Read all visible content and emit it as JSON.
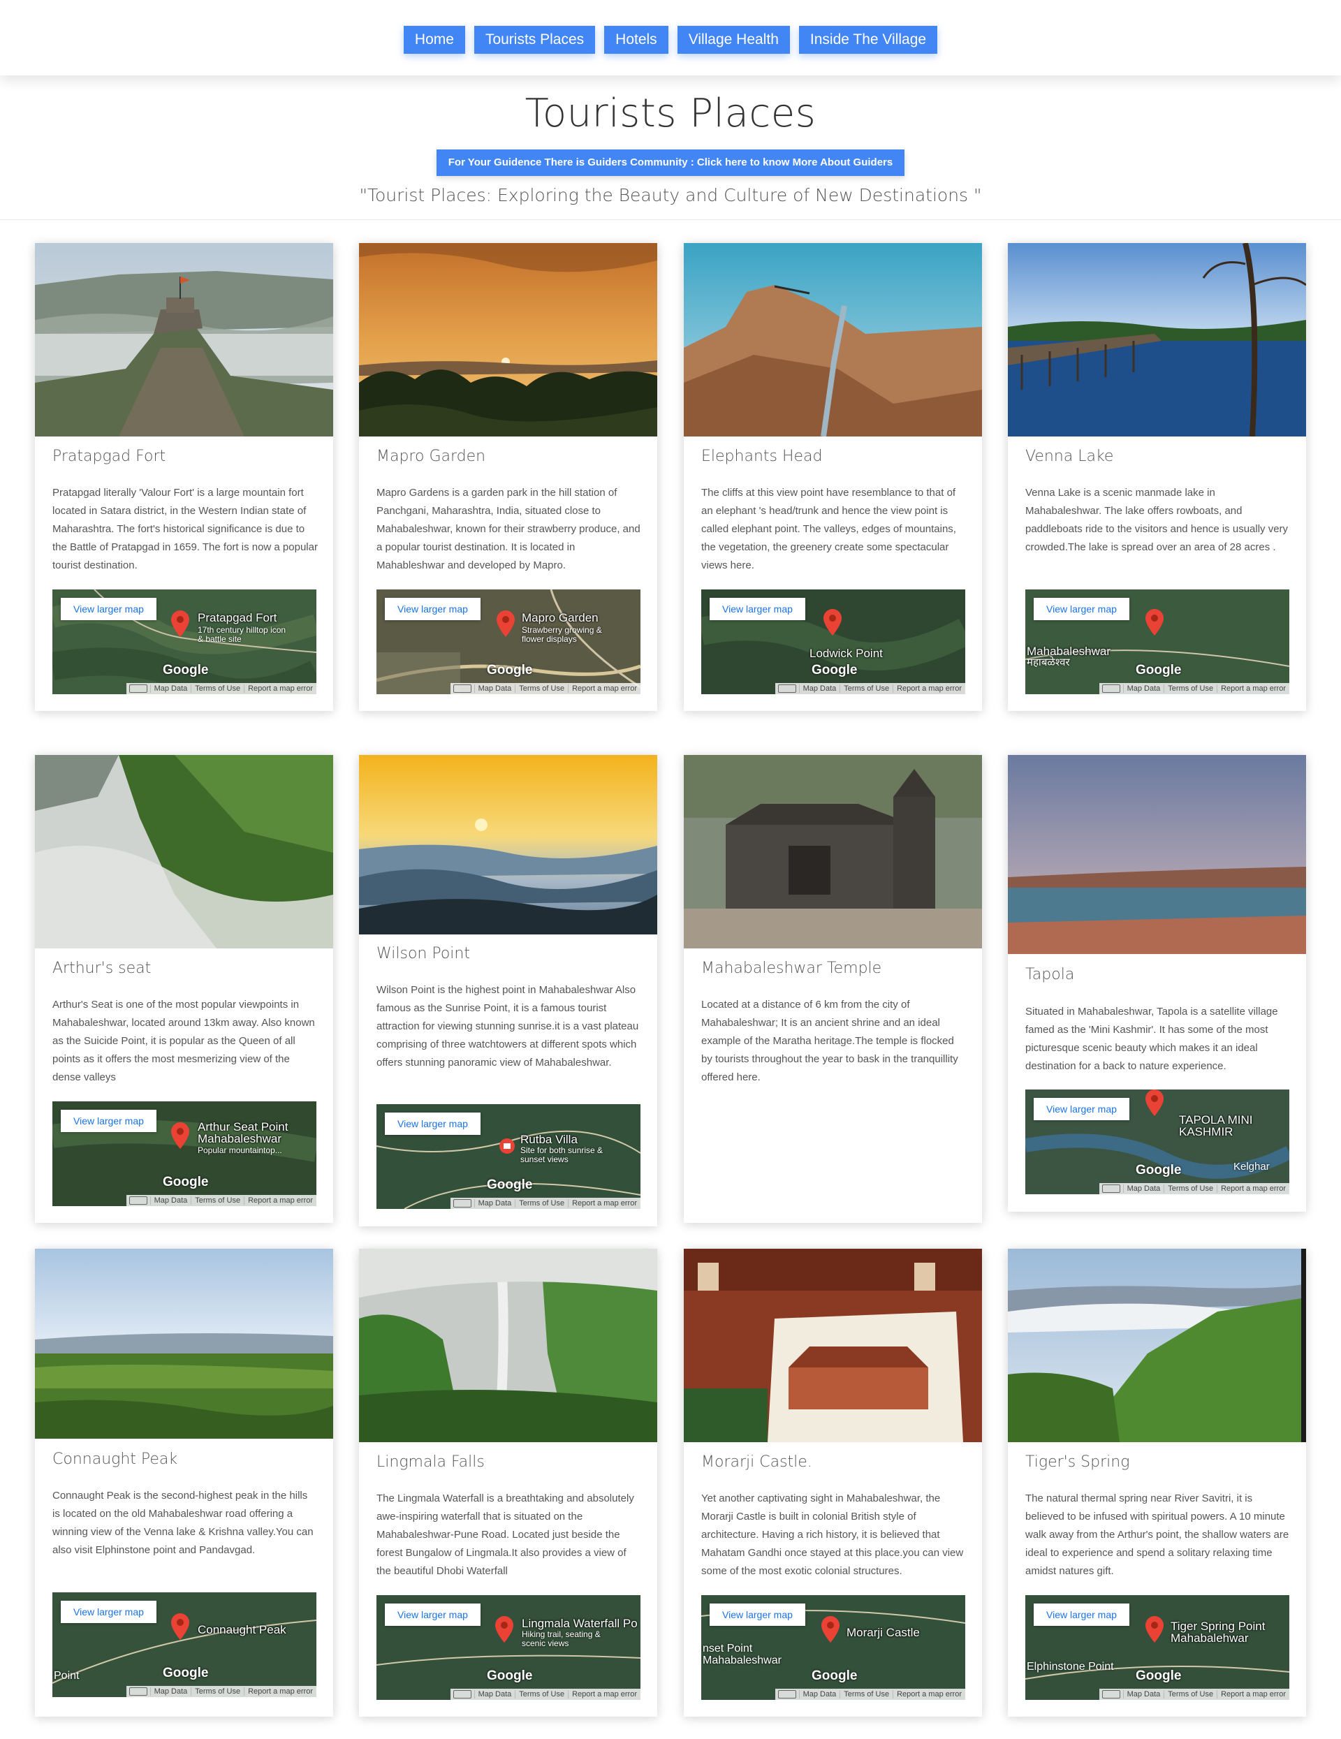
{
  "nav": [
    "Home",
    "Tourists Places",
    "Hotels",
    "Village Health",
    "Inside The Village"
  ],
  "header": {
    "title": "Tourists Places",
    "guide_button": "For Your Guidence There is Guiders Community : Click here to know More About Guiders",
    "tagline": "\"Tourist Places: Exploring the Beauty and Culture of New Destinations \""
  },
  "map_common": {
    "link": "View larger map",
    "google": "Google",
    "map_data": "Map Data",
    "terms": "Terms of Use",
    "report": "Report a map error"
  },
  "cards": [
    {
      "title": "Pratapgad Fort",
      "desc": "Pratapgad literally 'Valour Fort' is a large mountain fort located in Satara district, in the Western Indian state of Maharashtra. The fort's historical significance is due to the Battle of Pratapgad in 1659. The fort is now a popular tourist destination.",
      "map_label": "Pratapgad Fort",
      "map_sub": "17th century hilltop icon & battle site"
    },
    {
      "title": "Mapro Garden",
      "desc": "Mapro Gardens is a garden park in the hill station of Panchgani, Maharashtra, India, situated close to Mahabaleshwar, known for their strawberry produce, and a popular tourist destination. It is located in Mahableshwar and developed by Mapro.",
      "map_label": "Mapro Garden",
      "map_sub": "Strawberry growing & flower displays"
    },
    {
      "title": "Elephants Head",
      "desc": "The cliffs at this view point have resemblance to that of an elephant 's head/trunk and hence the view point is called elephant point. The valleys, edges of mountains, the vegetation, the greenery create some spectacular views here.",
      "map_label": "Lodwick Point",
      "map_sub": ""
    },
    {
      "title": "Venna Lake",
      "desc": "Venna Lake is a scenic manmade lake in Mahabaleshwar. The lake offers rowboats, and paddleboats ride to the visitors and hence is usually very crowded.The lake is spread over an area of 28 acres .",
      "map_label": "Mahabaleshwar",
      "map_sub": "महाबळेश्वर"
    },
    {
      "title": "Arthur's seat",
      "desc": "Arthur's Seat is one of the most popular viewpoints in Mahabaleshwar, located around 13km away. Also known as the Suicide Point, it is popular as the Queen of all points as it offers the most mesmerizing view of the dense valleys",
      "map_label": "Arthur Seat Point Mahabaleshwar",
      "map_sub": "Popular mountaintop..."
    },
    {
      "title": "Wilson Point",
      "desc": "Wilson Point is the highest point in Mahabaleshwar Also famous as the Sunrise Point, it is a famous tourist attraction for viewing stunning sunrise.it is a vast plateau comprising of three watchtowers at different spots which offers stunning panoramic view of Mahabaleshwar.",
      "map_label": "Rutba Villa",
      "map_sub": "Site for both sunrise & sunset views"
    },
    {
      "title": "Mahabaleshwar Temple",
      "desc": "Located at a distance of 6 km from the city of Mahabaleshwar; It is an ancient shrine and an ideal example of the Maratha heritage.The temple is flocked by tourists throughout the year to bask in the tranquillity offered here.",
      "map_label": "",
      "map_sub": ""
    },
    {
      "title": "Tapola",
      "desc": "Situated in Mahabaleshwar, Tapola is a satellite village famed as the 'Mini Kashmir'. It has some of the most picturesque scenic beauty which makes it an ideal destination for a back to nature experience.",
      "map_label": "TAPOLA MINI KASHMIR",
      "map_sub": "Kelghar"
    },
    {
      "title": "Connaught Peak",
      "desc": "Connaught Peak is the second-highest peak in the hills is located on the old Mahabaleshwar road offering a winning view of the Venna lake & Krishna valley.You can also visit Elphinstone point and Pandavgad.",
      "map_label": "Connaught Peak",
      "map_sub": "Point"
    },
    {
      "title": "Lingmala Falls",
      "desc": "The Lingmala Waterfall is a breathtaking and absolutely awe-inspiring waterfall that is situated on the Mahabaleshwar-Pune Road. Located just beside the forest Bungalow of Lingmala.It also provides a view of the beautiful Dhobi Waterfall",
      "map_label": "Lingmala Waterfall Po",
      "map_sub": "Hiking trail, seating & scenic views"
    },
    {
      "title": "Morarji Castle.",
      "desc": "Yet another captivating sight in Mahabaleshwar, the Morarji Castle is built in colonial British style of architecture. Having a rich history, it is believed that Mahatam Gandhi once stayed at this place.you can view some of the most exotic colonial structures.",
      "map_label": "Morarji Castle",
      "map_sub": "nset Point Mahabaleshwar"
    },
    {
      "title": "Tiger's Spring",
      "desc": "The natural thermal spring near River Savitri, it is believed to be infused with spiritual powers. A 10 minute walk away from the Arthur's point, the shallow waters are ideal to experience and spend a solitary relaxing time amidst natures gift.",
      "map_label": "Tiger Spring Point Mahabalehwar",
      "map_sub": "Elphinstone Point"
    }
  ]
}
